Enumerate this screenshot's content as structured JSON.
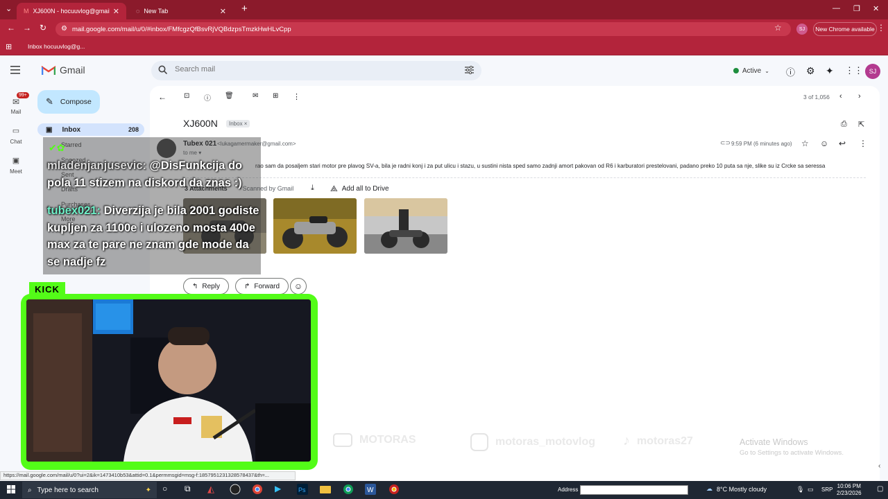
{
  "browser": {
    "tabs": [
      {
        "label": "XJ600N - hocuuvlog@gmail.co",
        "active": true
      },
      {
        "label": "New Tab",
        "active": false
      }
    ],
    "url": "mail.google.com/mail/u/0/#inbox/FMfcgzQfBsvRjVQBdzpsTmzkHwHLvCpp",
    "profile_initials": "SJ",
    "new_chrome_label": "New Chrome available",
    "bookmark": "Inbox hocuuvlog@g...",
    "status_link": "https://mail.google.com/mail/u/0?ui=2&ik=1473410b53&attid=0.1&permmsgid=msg-f:1857951231328578437&th=..."
  },
  "gmail": {
    "logo_text": "Gmail",
    "search_placeholder": "Search mail",
    "status": "Active",
    "avatar_initials": "SJ",
    "rail": {
      "mail": "Mail",
      "mail_badge": "99+",
      "chat": "Chat",
      "meet": "Meet"
    },
    "compose_label": "Compose",
    "nav": [
      {
        "label": "Inbox",
        "count": "208"
      },
      {
        "label": "Starred"
      },
      {
        "label": "Snoozed"
      },
      {
        "label": "Sent"
      },
      {
        "label": "Drafts"
      },
      {
        "label": "Purchases"
      },
      {
        "label": "More"
      }
    ],
    "pager": "3 of 1,056",
    "message": {
      "subject": "XJ600N",
      "label": "Inbox",
      "sender_name": "Tubex 021",
      "sender_email": "<lukagamermaker@gmail.com>",
      "to": "to me",
      "time": "9:59 PM (6 minutes ago)",
      "body": "rao sam da posaljem stari motor pre plavog SV-a, bila je radni konj i za put ulicu i stazu, u sustini nista sped samo zadnji amort pakovan od R6 i karburatori prestelovani, padano preko 10 puta sa nje, slike su iz Crcke sa seressa",
      "attachments_title": "3 Attachments",
      "scanned": "• Scanned by Gmail",
      "add_drive": "Add all to Drive",
      "reply": "Reply",
      "forward": "Forward"
    }
  },
  "chat": [
    {
      "user": "mladenjanjusevic:",
      "text": "@DisFunkcija do pola 11 stizem na diskord da znas :)"
    },
    {
      "user": "tubex021:",
      "text": "Diverzija je bila 2001 godiste kupljen za 1100e i ulozeno mosta 400e max za te pare ne znam gde mode da se nadje fz"
    }
  ],
  "stream": {
    "platform_tag": "KICK",
    "socials": [
      {
        "icon": "youtube-icon",
        "handle": "MOTORAS"
      },
      {
        "icon": "instagram-icon",
        "handle": "motoras_motovlog"
      },
      {
        "icon": "tiktok-icon",
        "handle": "motoras27"
      }
    ]
  },
  "windows": {
    "activate_title": "Activate Windows",
    "activate_sub": "Go to Settings to activate Windows.",
    "search_placeholder": "Type here to search",
    "address_label": "Address",
    "weather": "8°C  Mostly cloudy",
    "language": "SRP",
    "time": "10:06 PM",
    "date": "2/23/2026"
  },
  "colors": {
    "chrome_frame": "#8b1a2b",
    "chrome_toolbar": "#b3243b",
    "gmail_bg": "#f6f8fc",
    "compose": "#c2e7ff",
    "kick_green": "#53fc18"
  }
}
